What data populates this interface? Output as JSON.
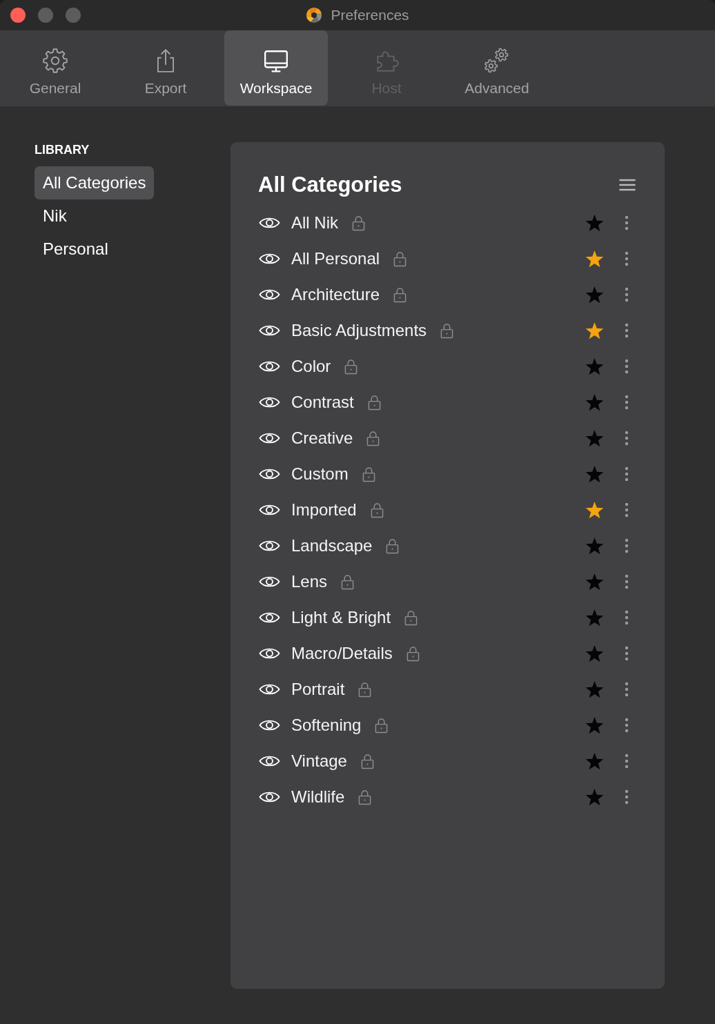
{
  "window": {
    "title": "Preferences"
  },
  "toolbar": {
    "tabs": [
      {
        "label": "General",
        "kind": "gear",
        "selected": false,
        "disabled": false
      },
      {
        "label": "Export",
        "kind": "export",
        "selected": false,
        "disabled": false
      },
      {
        "label": "Workspace",
        "kind": "monitor",
        "selected": true,
        "disabled": false
      },
      {
        "label": "Host",
        "kind": "puzzle",
        "selected": false,
        "disabled": true
      },
      {
        "label": "Advanced",
        "kind": "gears",
        "selected": false,
        "disabled": false
      }
    ]
  },
  "sidebar": {
    "heading": "LIBRARY",
    "items": [
      {
        "label": "All Categories",
        "selected": true
      },
      {
        "label": "Nik",
        "selected": false
      },
      {
        "label": "Personal",
        "selected": false
      }
    ]
  },
  "panel": {
    "title": "All Categories",
    "categories": [
      {
        "name": "All Nik",
        "favorite": false
      },
      {
        "name": "All Personal",
        "favorite": true
      },
      {
        "name": "Architecture",
        "favorite": false
      },
      {
        "name": "Basic Adjustments",
        "favorite": true
      },
      {
        "name": "Color",
        "favorite": false
      },
      {
        "name": "Contrast",
        "favorite": false
      },
      {
        "name": "Creative",
        "favorite": false
      },
      {
        "name": "Custom",
        "favorite": false
      },
      {
        "name": "Imported",
        "favorite": true
      },
      {
        "name": "Landscape",
        "favorite": false
      },
      {
        "name": "Lens",
        "favorite": false
      },
      {
        "name": "Light & Bright",
        "favorite": false
      },
      {
        "name": "Macro/Details",
        "favorite": false
      },
      {
        "name": "Portrait",
        "favorite": false
      },
      {
        "name": "Softening",
        "favorite": false
      },
      {
        "name": "Vintage",
        "favorite": false
      },
      {
        "name": "Wildlife",
        "favorite": false
      }
    ]
  }
}
